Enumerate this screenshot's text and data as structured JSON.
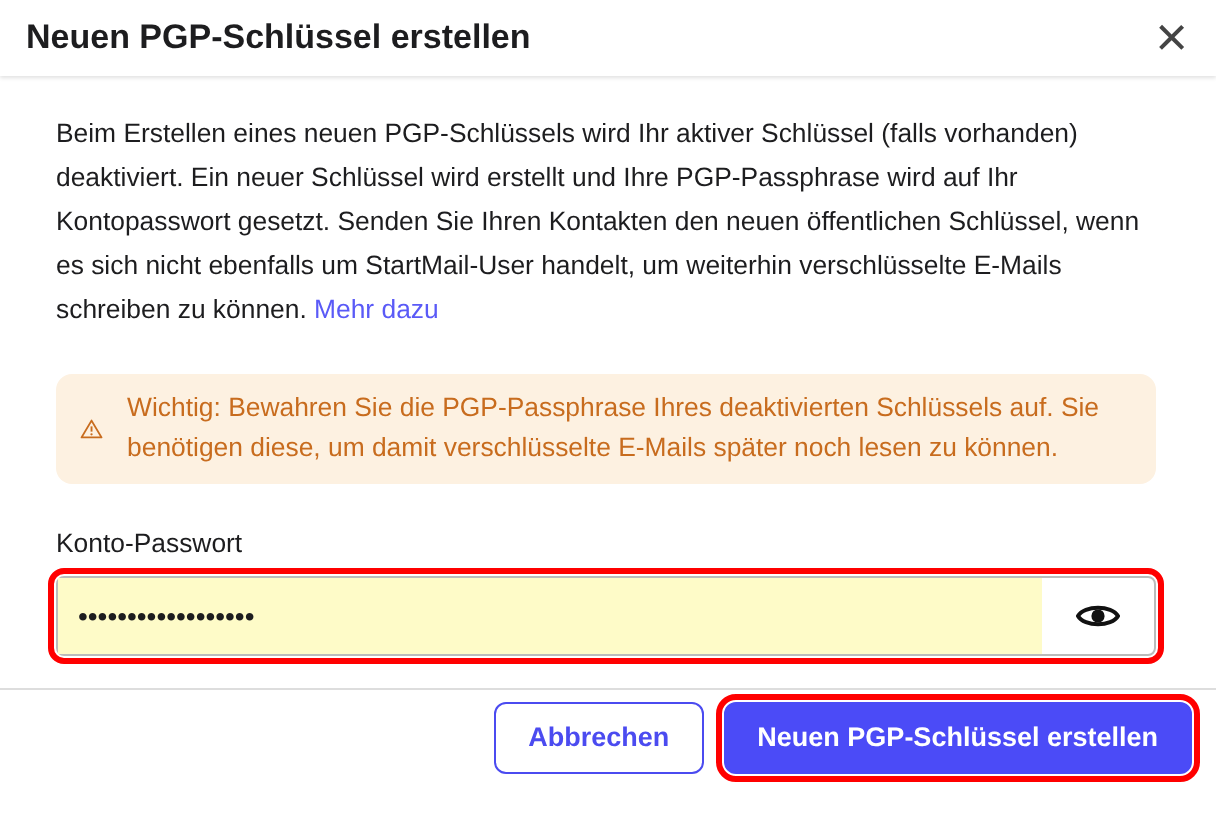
{
  "dialog": {
    "title": "Neuen PGP-Schlüssel erstellen",
    "close": "×"
  },
  "intro": {
    "text": "Beim Erstellen eines neuen PGP-Schlüssels wird Ihr aktiver Schlüssel (falls vorhanden) deaktiviert. Ein neuer Schlüssel wird erstellt und Ihre PGP-Passphrase wird auf Ihr Kontopasswort gesetzt. Senden Sie Ihren Kontakten den neuen öffentlichen Schlüssel, wenn es sich nicht ebenfalls um StartMail-User handelt, um weiterhin verschlüsselte E-Mails schreiben zu können.",
    "link": "Mehr dazu"
  },
  "warning": {
    "text": "Wichtig: Bewahren Sie die PGP-Passphrase Ihres deaktivierten Schlüssels auf. Sie benötigen diese, um damit verschlüsselte E-Mails später noch lesen zu können."
  },
  "password_field": {
    "label": "Konto-Passwort",
    "value": "••••••••••••••••••",
    "highlighted": true
  },
  "buttons": [
    {
      "label": "Abbrechen",
      "kind": "secondary",
      "highlighted": false
    },
    {
      "label": "Neuen PGP-Schlüssel erstellen",
      "kind": "primary",
      "highlighted": true
    }
  ]
}
